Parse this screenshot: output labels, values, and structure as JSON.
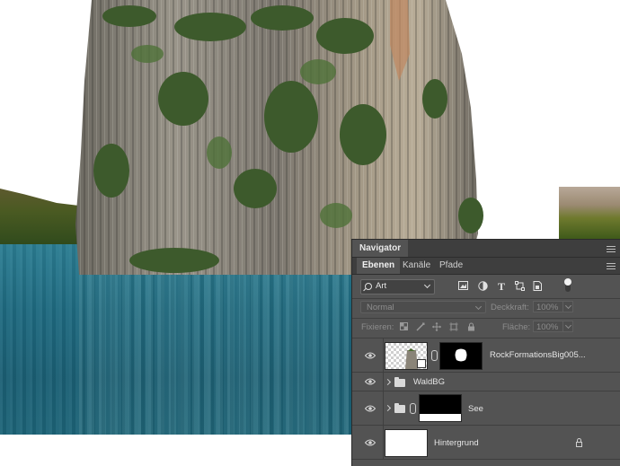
{
  "panel": {
    "navigator_tab": "Navigator",
    "tabs": [
      {
        "label": "Ebenen",
        "active": true
      },
      {
        "label": "Kanäle",
        "active": false
      },
      {
        "label": "Pfade",
        "active": false
      }
    ],
    "filter": {
      "value": "Art",
      "icon": "search-icon"
    },
    "filter_icons": [
      "image-filter-icon",
      "adjustment-filter-icon",
      "type-filter-icon",
      "shape-filter-icon",
      "smart-object-filter-icon",
      "filter-toggle"
    ],
    "blend_mode": "Normal",
    "opacity_label": "Deckkraft:",
    "opacity_value": "100%",
    "lock_label": "Fixieren:",
    "fill_label": "Fläche:",
    "fill_value": "100%",
    "layers": [
      {
        "name": "RockFormationsBig005...",
        "visible": true,
        "type": "smart-object-with-mask"
      },
      {
        "name": "WaldBG",
        "visible": true,
        "type": "group"
      },
      {
        "name": "See",
        "visible": true,
        "type": "group-with-mask"
      },
      {
        "name": "Hintergrund",
        "visible": true,
        "type": "background",
        "locked": true
      }
    ]
  },
  "colors": {
    "panel_bg": "#535353",
    "tab_bar_bg": "#3e3e3e",
    "water": "#1f6a80"
  }
}
